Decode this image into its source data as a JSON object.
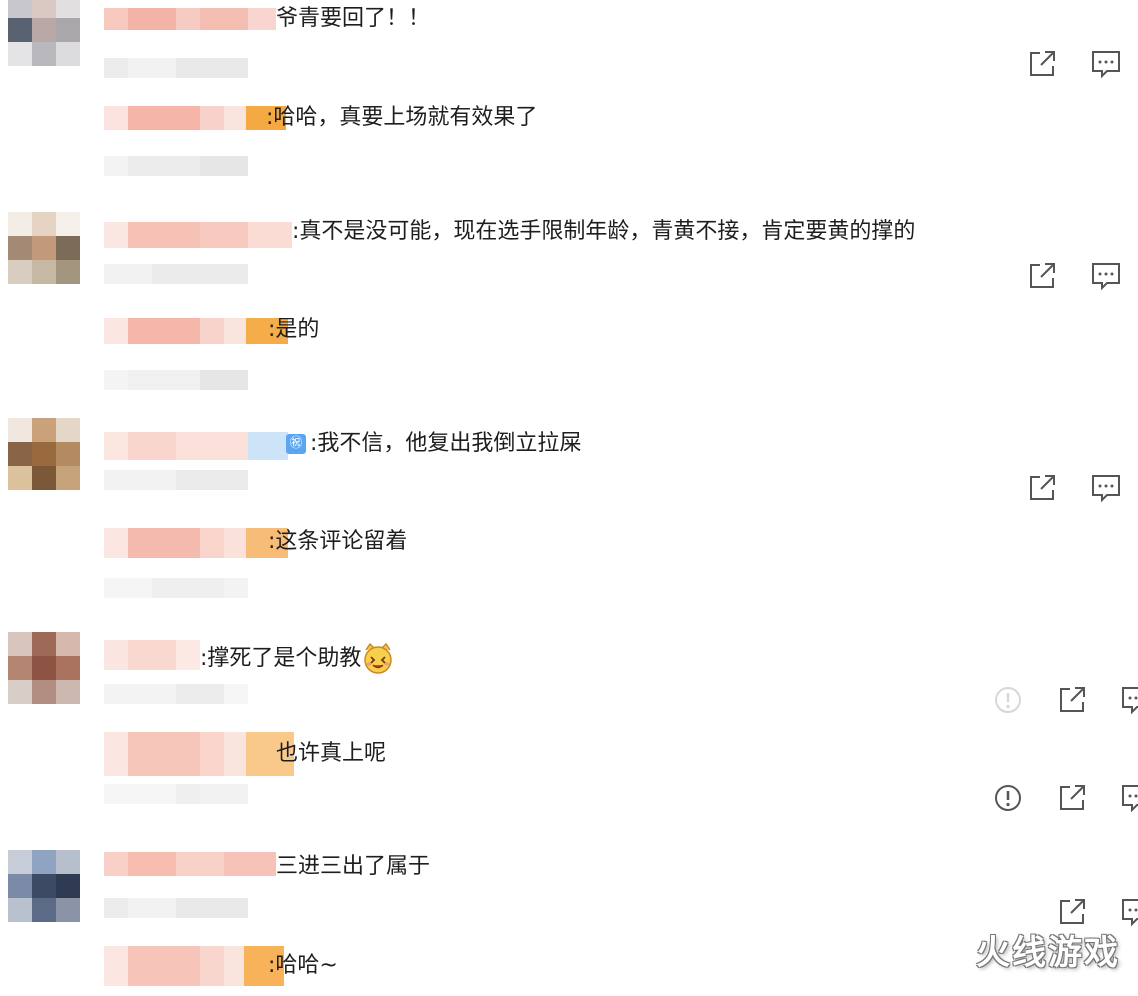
{
  "comments": [
    {
      "main_text": "爷青要回了！！",
      "reply_text": ":哈哈，真要上场就有效果了"
    },
    {
      "main_text": ":真不是没可能，现在选手限制年龄，青黄不接，肯定要黄的撑的",
      "reply_text": ":是的"
    },
    {
      "main_text": ":我不信，他复出我倒立拉屎",
      "vip_badge": "㊗",
      "reply_text": ":这条评论留着"
    },
    {
      "main_text": ":撑死了是个助教",
      "reply_text": "也许真上呢"
    },
    {
      "main_text": "三进三出了属于",
      "reply_text": ":哈哈~"
    }
  ],
  "icons": {
    "share": "share-icon",
    "comment": "comment-icon",
    "report": "report-icon",
    "emoji": "grinning-cat-emoji"
  },
  "watermark": "火线游戏",
  "colors": {
    "blur_pink": "#f7c1b4",
    "blur_orange": "#f5a942",
    "blur_gray": "#ececec",
    "icon": "#555555"
  }
}
